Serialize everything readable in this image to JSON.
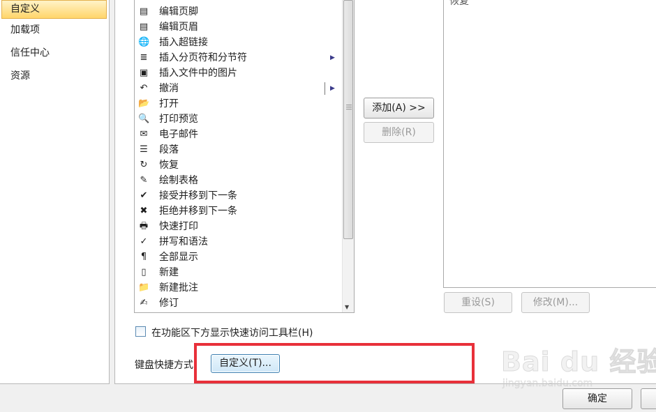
{
  "nav": {
    "items": [
      {
        "label": "自定义",
        "selected": true
      },
      {
        "label": "加载项"
      },
      {
        "label": "信任中心"
      },
      {
        "label": "资源"
      }
    ]
  },
  "commands": [
    {
      "label": "编辑页脚",
      "icon": "page-footer-icon",
      "glyph": "▤"
    },
    {
      "label": "编辑页眉",
      "icon": "page-header-icon",
      "glyph": "▤"
    },
    {
      "label": "插入超链接",
      "icon": "hyperlink-icon",
      "glyph": "🌐"
    },
    {
      "label": "插入分页符和分节符",
      "icon": "page-break-icon",
      "glyph": "≣",
      "submenu": true
    },
    {
      "label": "插入文件中的图片",
      "icon": "picture-icon",
      "glyph": "▣"
    },
    {
      "label": "撤消",
      "icon": "undo-icon",
      "glyph": "↶",
      "split": true,
      "submenu": true
    },
    {
      "label": "打开",
      "icon": "folder-open-icon",
      "glyph": "📂"
    },
    {
      "label": "打印预览",
      "icon": "print-preview-icon",
      "glyph": "🔍"
    },
    {
      "label": "电子邮件",
      "icon": "email-icon",
      "glyph": "✉"
    },
    {
      "label": "段落",
      "icon": "paragraph-icon",
      "glyph": "☰"
    },
    {
      "label": "恢复",
      "icon": "redo-icon",
      "glyph": "↻"
    },
    {
      "label": "绘制表格",
      "icon": "draw-table-icon",
      "glyph": "✎"
    },
    {
      "label": "接受并移到下一条",
      "icon": "accept-change-icon",
      "glyph": "✔"
    },
    {
      "label": "拒绝并移到下一条",
      "icon": "reject-change-icon",
      "glyph": "✖"
    },
    {
      "label": "快速打印",
      "icon": "quick-print-icon",
      "glyph": "🖶"
    },
    {
      "label": "拼写和语法",
      "icon": "spelling-icon",
      "glyph": "✓"
    },
    {
      "label": "全部显示",
      "icon": "show-all-icon",
      "glyph": "¶"
    },
    {
      "label": "新建",
      "icon": "new-document-icon",
      "glyph": "▯"
    },
    {
      "label": "新建批注",
      "icon": "new-comment-icon",
      "glyph": "📁"
    },
    {
      "label": "修订",
      "icon": "track-changes-icon",
      "glyph": "✍"
    }
  ],
  "buttons": {
    "add": "添加(A) >>",
    "remove": "删除(R)",
    "reset": "重设(S)",
    "modify": "修改(M)...",
    "customize": "自定义(T)...",
    "ok": "确定"
  },
  "right_list": {
    "partial_item": "恢复"
  },
  "checkbox": {
    "label": "在功能区下方显示快速访问工具栏(H)",
    "checked": false
  },
  "keyboard": {
    "label": "键盘快捷方式:"
  },
  "watermark": {
    "main": "Bai du 经验",
    "sub": "jingyan.baidu.com"
  },
  "colors": {
    "highlight": "#e8303a",
    "selected_nav": "#ffd56a"
  }
}
